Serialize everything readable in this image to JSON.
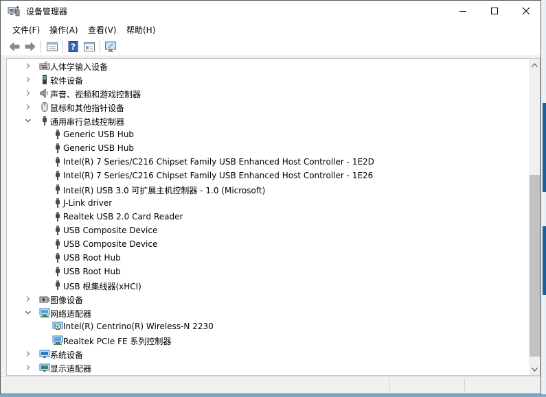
{
  "window": {
    "title": "设备管理器"
  },
  "menu": [
    "文件(F)",
    "操作(A)",
    "查看(V)",
    "帮助(H)"
  ],
  "toolbar": {
    "buttons": [
      "back-arrow-icon",
      "forward-arrow-icon",
      "properties-icon",
      "help-icon",
      "view-icon",
      "monitor-icon"
    ]
  },
  "tree": {
    "rows": [
      {
        "label": "人体学输入设备",
        "level": 0,
        "expanded": false,
        "icon": "hid-device-icon"
      },
      {
        "label": "软件设备",
        "level": 0,
        "expanded": false,
        "icon": "software-device-icon"
      },
      {
        "label": "声音、视频和游戏控制器",
        "level": 0,
        "expanded": false,
        "icon": "speaker-icon"
      },
      {
        "label": "鼠标和其他指针设备",
        "level": 0,
        "expanded": false,
        "icon": "mouse-icon"
      },
      {
        "label": "通用串行总线控制器",
        "level": 0,
        "expanded": true,
        "icon": "usb-icon"
      },
      {
        "label": "Generic USB Hub",
        "level": 1,
        "icon": "usb-icon"
      },
      {
        "label": "Generic USB Hub",
        "level": 1,
        "icon": "usb-icon"
      },
      {
        "label": "Intel(R) 7 Series/C216 Chipset Family USB Enhanced Host Controller - 1E2D",
        "level": 1,
        "icon": "usb-icon"
      },
      {
        "label": "Intel(R) 7 Series/C216 Chipset Family USB Enhanced Host Controller - 1E26",
        "level": 1,
        "icon": "usb-icon"
      },
      {
        "label": "Intel(R) USB 3.0 可扩展主机控制器 - 1.0 (Microsoft)",
        "level": 1,
        "icon": "usb-icon"
      },
      {
        "label": "J-Link driver",
        "level": 1,
        "icon": "usb-icon"
      },
      {
        "label": "Realtek USB 2.0 Card Reader",
        "level": 1,
        "icon": "usb-icon"
      },
      {
        "label": "USB Composite Device",
        "level": 1,
        "icon": "usb-icon"
      },
      {
        "label": "USB Composite Device",
        "level": 1,
        "icon": "usb-icon"
      },
      {
        "label": "USB Root Hub",
        "level": 1,
        "icon": "usb-icon"
      },
      {
        "label": "USB Root Hub",
        "level": 1,
        "icon": "usb-icon"
      },
      {
        "label": "USB 根集线器(xHCI)",
        "level": 1,
        "icon": "usb-icon"
      },
      {
        "label": "图像设备",
        "level": 0,
        "expanded": false,
        "icon": "camera-icon"
      },
      {
        "label": "网络适配器",
        "level": 0,
        "expanded": true,
        "icon": "network-adapter-icon"
      },
      {
        "label": "Intel(R) Centrino(R) Wireless-N 2230",
        "level": 1,
        "icon": "network-adapter-warning-icon"
      },
      {
        "label": "Realtek PCIe FE 系列控制器",
        "level": 1,
        "icon": "network-adapter-icon"
      },
      {
        "label": "系统设备",
        "level": 0,
        "expanded": false,
        "icon": "system-device-icon"
      },
      {
        "label": "显示适配器",
        "level": 0,
        "expanded": false,
        "icon": "display-adapter-icon"
      }
    ]
  },
  "colors": {
    "accent": "#0078d7",
    "selection": "#cce8ff",
    "scroll_thumb": "#c2c2c2"
  }
}
